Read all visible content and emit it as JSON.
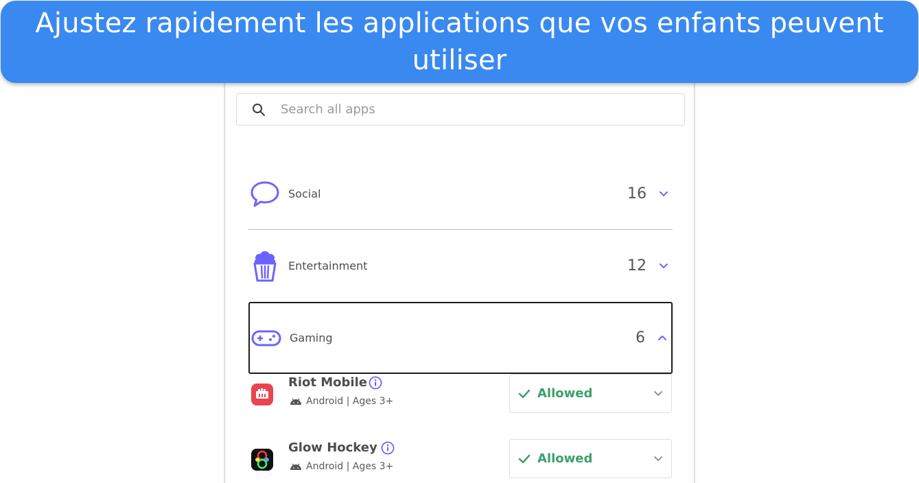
{
  "banner": {
    "text": "Ajustez rapidement les applications que vos enfants peuvent utiliser",
    "color": "#3a89f0"
  },
  "search": {
    "placeholder": "Search all apps",
    "icon": "search-icon"
  },
  "categories": [
    {
      "label": "Social",
      "count": "16",
      "icon": "chat-bubble-icon",
      "expanded": false
    },
    {
      "label": "Entertainment",
      "count": "12",
      "icon": "popcorn-icon",
      "expanded": false
    },
    {
      "label": "Gaming",
      "count": "6",
      "icon": "gamepad-icon",
      "expanded": true
    }
  ],
  "apps": [
    {
      "name": "Riot Mobile",
      "platform": "Android",
      "ages": "Ages 3+",
      "status": "Allowed",
      "icon": "riot-fist-icon"
    },
    {
      "name": "Glow Hockey",
      "platform": "Android",
      "ages": "Ages 3+",
      "status": "Allowed",
      "icon": "glow-hockey-icon"
    }
  ],
  "colors": {
    "accent": "#6c63ff",
    "allowed": "#3aa06a"
  }
}
